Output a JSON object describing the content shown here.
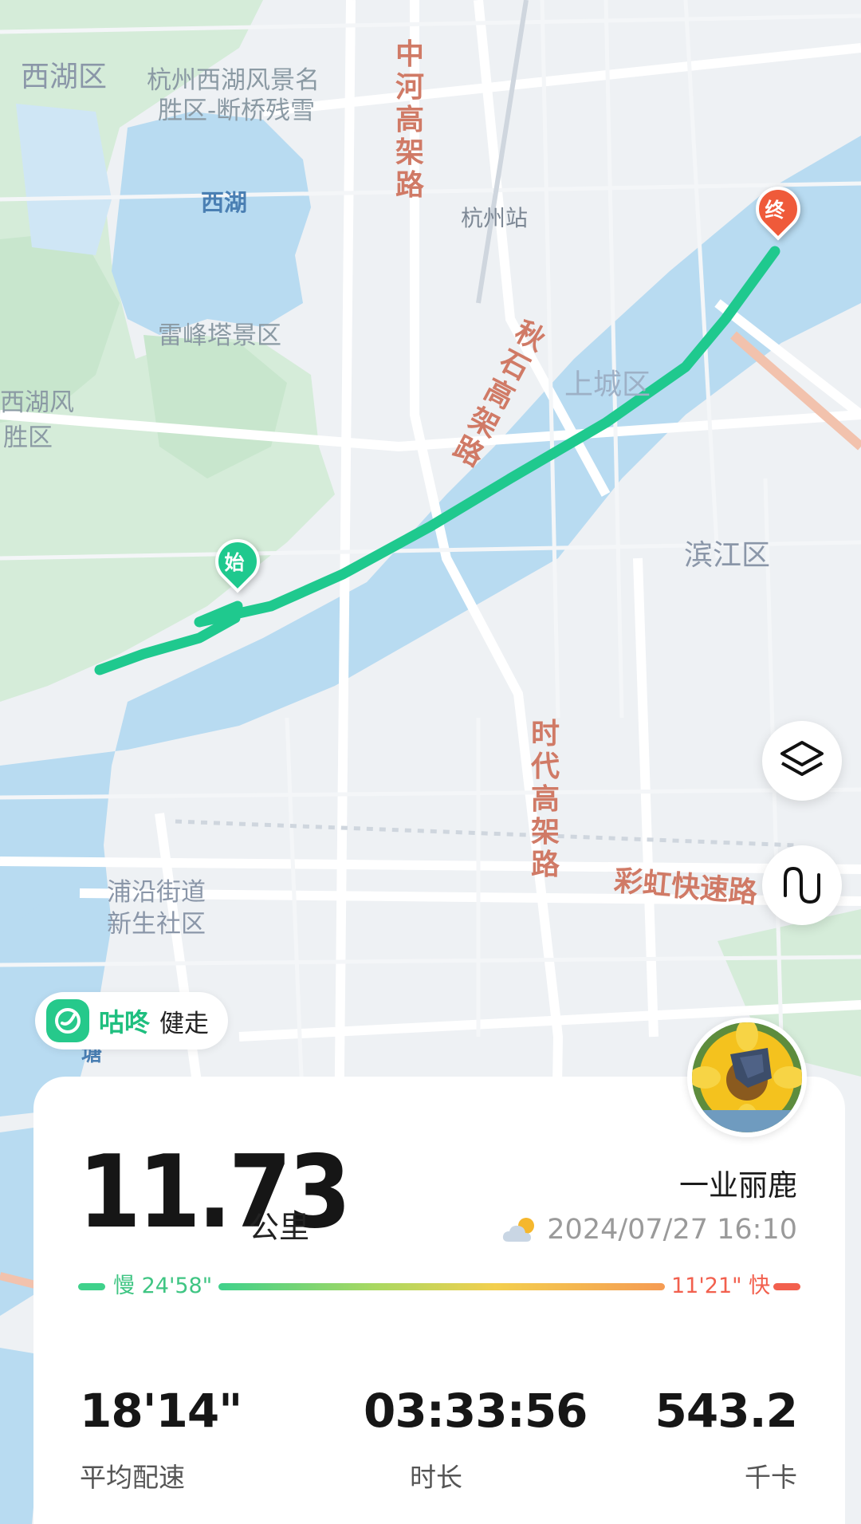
{
  "map": {
    "labels": {
      "xihu_district": "西湖区",
      "scenic_area_1": "杭州西湖风景名",
      "scenic_area_2": "胜区-断桥残雪",
      "west_lake": "西湖",
      "leifeng": "雷峰塔景区",
      "scenic_left_1": "西湖风",
      "scenic_left_2": "胜区",
      "zhonghe_road": "中河高架路",
      "hangzhou_station": "杭州站",
      "qiushi_road": "秋石高架路",
      "shangcheng": "上城区",
      "binjiang": "滨江区",
      "shidai_road": "时代高架路",
      "rainbow_road": "彩虹快速路",
      "puyan_1": "浦沿街道",
      "puyan_2": "新生社区",
      "tang": "塘"
    },
    "start_marker": "始",
    "end_marker": "终",
    "route_color": "#1fc98e",
    "layers_icon": "layers-icon",
    "route_icon": "route-icon"
  },
  "brand": {
    "name": "咕咚",
    "mode": "健走",
    "logo_icon": "codoon-logo-icon"
  },
  "summary": {
    "distance": "11.73",
    "distance_unit": "公里",
    "username": "一业丽鹿",
    "weather_icon": "partly-cloudy-icon",
    "datetime": "2024/07/27 16:10",
    "pace_slow": "慢 24'58\"",
    "pace_fast": "11'21\" 快",
    "slow_color": "#3fd18b",
    "fast_color": "#f2604e"
  },
  "stats": [
    {
      "value": "18'14\"",
      "label": "平均配速"
    },
    {
      "value": "03:33:56",
      "label": "时长"
    },
    {
      "value": "543.2",
      "label": "千卡"
    }
  ]
}
